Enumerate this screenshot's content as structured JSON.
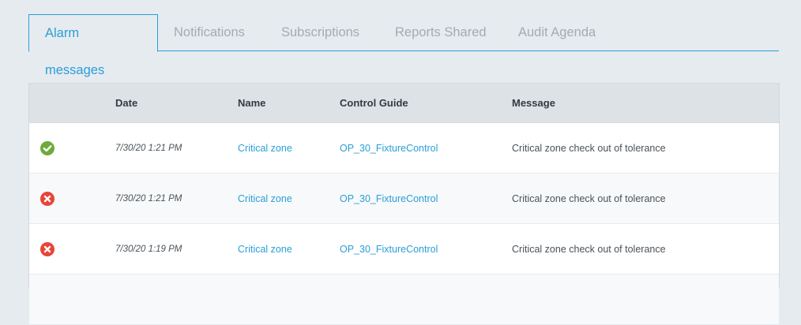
{
  "tabs": [
    {
      "label": "Alarm messages",
      "active": true
    },
    {
      "label": "Notifications",
      "active": false
    },
    {
      "label": "Subscriptions",
      "active": false
    },
    {
      "label": "Reports Shared",
      "active": false
    },
    {
      "label": "Audit Agenda",
      "active": false
    }
  ],
  "colors": {
    "accent": "#2a9fd8",
    "ok": "#6cab3c",
    "error": "#e8443a",
    "background": "#e6ebef"
  },
  "table": {
    "columns": [
      "",
      "Date",
      "Name",
      "Control Guide",
      "Message"
    ],
    "rows": [
      {
        "status": "ok",
        "status_icon": "check-circle-icon",
        "date": "7/30/20 1:21 PM",
        "name": "Critical zone",
        "guide": "OP_30_FixtureControl",
        "message": "Critical zone check out of tolerance"
      },
      {
        "status": "error",
        "status_icon": "x-circle-icon",
        "date": "7/30/20 1:21 PM",
        "name": "Critical zone",
        "guide": "OP_30_FixtureControl",
        "message": "Critical zone check out of tolerance"
      },
      {
        "status": "error",
        "status_icon": "x-circle-icon",
        "date": "7/30/20 1:19 PM",
        "name": "Critical zone",
        "guide": "OP_30_FixtureControl",
        "message": "Critical zone check out of tolerance"
      }
    ]
  }
}
